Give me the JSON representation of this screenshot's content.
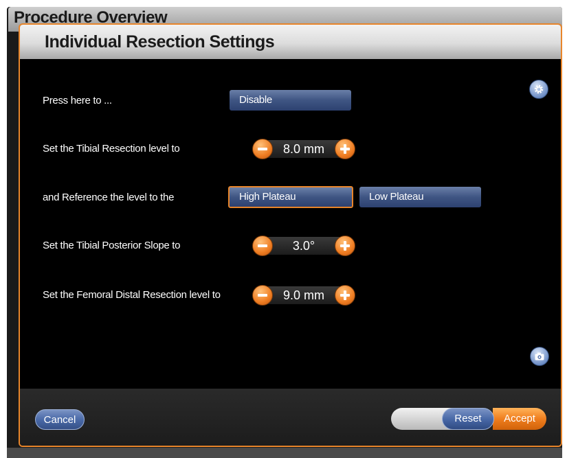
{
  "background": {
    "title": "Procedure Overview"
  },
  "dialog": {
    "title": "Individual Resection Settings",
    "accent_color": "#e8852a",
    "button_color": "#3f5583"
  },
  "rows": {
    "press": {
      "label": "Press here to ...",
      "button": "Disable"
    },
    "tibial_resection": {
      "label": "Set the Tibial Resection level to",
      "value": "8.0 mm"
    },
    "reference": {
      "label": "and Reference the level to the",
      "options": [
        "High Plateau",
        "Low Plateau"
      ],
      "selected": "High Plateau"
    },
    "tibial_slope": {
      "label": "Set the Tibial Posterior Slope to",
      "value": "3.0°"
    },
    "femoral_distal": {
      "label": "Set the Femoral Distal Resection level to",
      "value": "9.0 mm"
    }
  },
  "icons": {
    "settings": "gear-icon",
    "screenshot": "camera-icon",
    "decrement": "minus-icon",
    "increment": "plus-icon"
  },
  "footer": {
    "cancel_label": "Cancel",
    "reset_label": "Reset",
    "accept_label": "Accept"
  }
}
